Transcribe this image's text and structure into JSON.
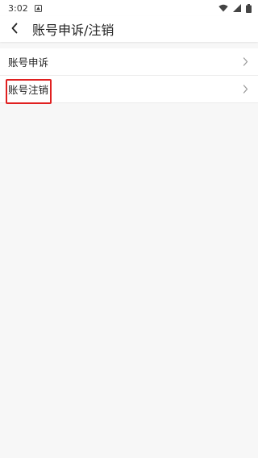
{
  "status_bar": {
    "time": "3:02",
    "icons": [
      "notification-icon",
      "wifi-icon",
      "signal-icon",
      "battery-icon"
    ]
  },
  "header": {
    "title": "账号申诉/注销",
    "back_icon": "chevron-left-icon"
  },
  "list": {
    "items": [
      {
        "label": "账号申诉",
        "icon": "chevron-right-icon"
      },
      {
        "label": "账号注销",
        "icon": "chevron-right-icon"
      }
    ]
  },
  "colors": {
    "background": "#f7f7f7",
    "surface": "#ffffff",
    "highlight": "#e02020",
    "text": "#222222",
    "chevron": "#9a9a9a"
  }
}
